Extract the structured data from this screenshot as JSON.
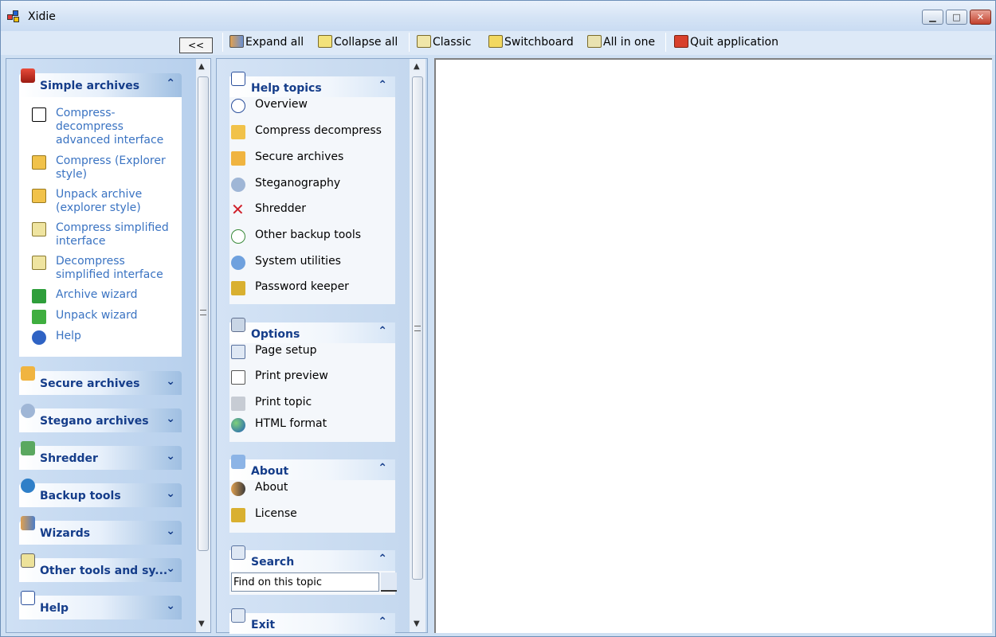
{
  "window": {
    "title": "Xidie",
    "controls": {
      "minimize": "▁",
      "maximize": "□",
      "close": "✕"
    }
  },
  "toolbar": {
    "collapse_pane": "<<",
    "items": [
      {
        "label": "Expand all",
        "icon": "users-icon"
      },
      {
        "label": "Collapse all",
        "icon": "collapse-icon"
      },
      {
        "label": "Classic",
        "icon": "classic-icon"
      },
      {
        "label": "Switchboard",
        "icon": "switchboard-icon"
      },
      {
        "label": "All in one",
        "icon": "all-in-one-icon"
      },
      {
        "label": "Quit application",
        "icon": "quit-icon"
      }
    ]
  },
  "left_pane": {
    "groups": [
      {
        "label": "Simple archives",
        "expanded": true,
        "chevron": "⌃"
      },
      {
        "label": "Secure archives",
        "expanded": false,
        "chevron": "⌄"
      },
      {
        "label": "Stegano archives",
        "expanded": false,
        "chevron": "⌄"
      },
      {
        "label": "Shredder",
        "expanded": false,
        "chevron": "⌄"
      },
      {
        "label": "Backup tools",
        "expanded": false,
        "chevron": "⌄"
      },
      {
        "label": "Wizards",
        "expanded": false,
        "chevron": "⌄"
      },
      {
        "label": "Other tools and sy...",
        "expanded": false,
        "chevron": "⌄"
      },
      {
        "label": "Help",
        "expanded": false,
        "chevron": "⌄"
      }
    ],
    "simple_items": [
      {
        "label": "Compress-decompress advanced interface",
        "icon": "document-tree-icon"
      },
      {
        "label": "Compress (Explorer style)",
        "icon": "archive-icon"
      },
      {
        "label": "Unpack archive (explorer style)",
        "icon": "archive-icon"
      },
      {
        "label": "Compress simplified interface",
        "icon": "calendar-archive-icon"
      },
      {
        "label": "Decompress simplified interface",
        "icon": "calendar-archive-icon"
      },
      {
        "label": "Archive wizard",
        "icon": "green-arrow-icon"
      },
      {
        "label": "Unpack wizard",
        "icon": "green-flag-icon"
      },
      {
        "label": "Help",
        "icon": "help-icon"
      }
    ]
  },
  "mid_pane": {
    "help_topics": {
      "label": "Help topics",
      "items": [
        "Overview",
        "Compress decompress",
        "Secure archives",
        "Steganography",
        "Shredder",
        "Other backup tools",
        "System utilities",
        "Password keeper"
      ]
    },
    "options": {
      "label": "Options",
      "items": [
        "Page setup",
        "Print preview",
        "Print topic",
        "HTML format"
      ]
    },
    "about": {
      "label": "About",
      "items": [
        "About",
        "License"
      ]
    },
    "search": {
      "label": "Search",
      "input_value": "Find on this topic"
    },
    "exit": {
      "label": "Exit"
    }
  },
  "scroll": {
    "up": "▲",
    "down": "▼"
  },
  "colors": {
    "group_header_text": "#153d8a",
    "link_text": "#3a73c2",
    "pane_bg": "#c3d7ee"
  }
}
